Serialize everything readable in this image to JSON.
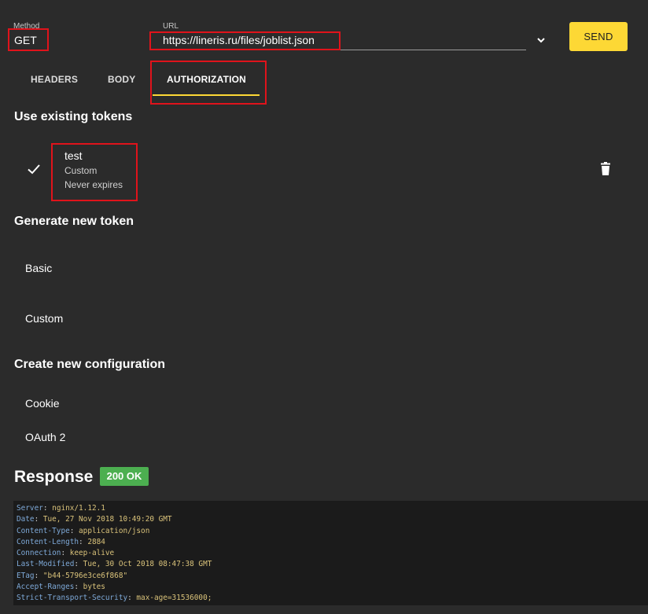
{
  "request": {
    "method_label": "Method",
    "method_value": "GET",
    "url_label": "URL",
    "url_value": "https://lineris.ru/files/joblist.json",
    "send_label": "SEND"
  },
  "tabs": [
    {
      "label": "HEADERS",
      "active": false
    },
    {
      "label": "BODY",
      "active": false
    },
    {
      "label": "AUTHORIZATION",
      "active": true
    }
  ],
  "existing_tokens": {
    "title": "Use existing tokens",
    "items": [
      {
        "name": "test",
        "type": "Custom",
        "expiry": "Never expires",
        "selected": true
      }
    ]
  },
  "generate_token": {
    "title": "Generate new token",
    "items": [
      "Basic",
      "Custom"
    ]
  },
  "create_config": {
    "title": "Create new configuration",
    "items": [
      "Cookie",
      "OAuth 2"
    ]
  },
  "response": {
    "title": "Response",
    "status": "200 OK",
    "status_color": "#4caf50",
    "headers": [
      {
        "key": "Server",
        "value": "nginx/1.12.1"
      },
      {
        "key": "Date",
        "value": "Tue, 27 Nov 2018 10:49:20 GMT"
      },
      {
        "key": "Content-Type",
        "value": "application/json"
      },
      {
        "key": "Content-Length",
        "value": "2884"
      },
      {
        "key": "Connection",
        "value": "keep-alive"
      },
      {
        "key": "Last-Modified",
        "value": "Tue, 30 Oct 2018 08:47:38 GMT"
      },
      {
        "key": "ETag",
        "value": "\"b44-5796e3ce6f868\""
      },
      {
        "key": "Accept-Ranges",
        "value": "bytes"
      },
      {
        "key": "Strict-Transport-Security",
        "value": "max-age=31536000;"
      }
    ]
  },
  "colors": {
    "background": "#2b2b2b",
    "accent": "#fdd835",
    "highlight_box": "#e0131b"
  },
  "icons": {
    "url_dropdown": "chevron-down-icon",
    "token_selected": "check-icon",
    "token_delete": "trash-icon"
  }
}
